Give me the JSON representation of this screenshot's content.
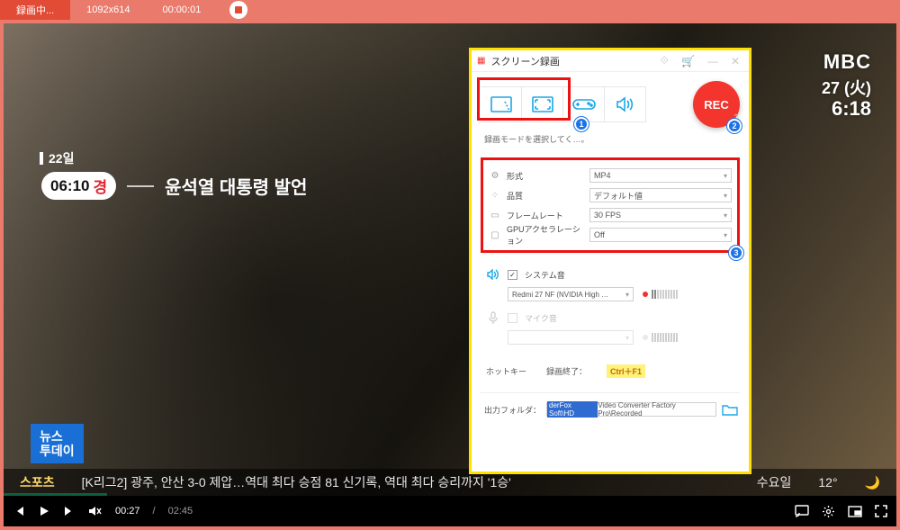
{
  "topbar": {
    "status": "録画中...",
    "resolution": "1092x614",
    "elapsed": "00:00:01"
  },
  "broadcast": {
    "logo": "MBC",
    "date": "27 (火)",
    "time": "6:18",
    "ovl_date": "22일",
    "pill_time": "06:10",
    "pill_suffix": "경",
    "headline": "윤석열 대통령 발언",
    "news_badge_l1": "뉴스",
    "news_badge_l2": "투데이",
    "ticker_sport": "스포츠",
    "ticker_text": "[K리그2] 광주, 안산 3-0 제압…역대 최다 승점 81 신기록, 역대 최다 승리까지 '1승'",
    "ticker_wed": "수요일",
    "ticker_temp": "12°"
  },
  "player": {
    "cur": "00:27",
    "dur": "02:45"
  },
  "recorder": {
    "title": "スクリーン録画",
    "hint": "録画モードを選択してく…。",
    "recLabel": "REC",
    "rows": {
      "format": {
        "label": "形式",
        "value": "MP4"
      },
      "quality": {
        "label": "品質",
        "value": "デフォルト値"
      },
      "fps": {
        "label": "フレームレート",
        "value": "30 FPS"
      },
      "gpu": {
        "label": "GPUアクセラレーション",
        "value": "Off"
      }
    },
    "audio": {
      "sys_label": "システム音",
      "sys_device": "Redmi 27 NF (NVIDIA High …",
      "mic_label": "マイク音",
      "mic_device": ""
    },
    "hotkey": {
      "label": "ホットキー",
      "end_label": "録画終了：",
      "end_key": "Ctrl＋F1"
    },
    "output": {
      "label": "出力フォルダ：",
      "selected": "derFox Soft\\HD",
      "rest": " Video Converter Factory Pro\\Recorded"
    }
  },
  "badges": {
    "b1": "1",
    "b2": "2",
    "b3": "3"
  }
}
